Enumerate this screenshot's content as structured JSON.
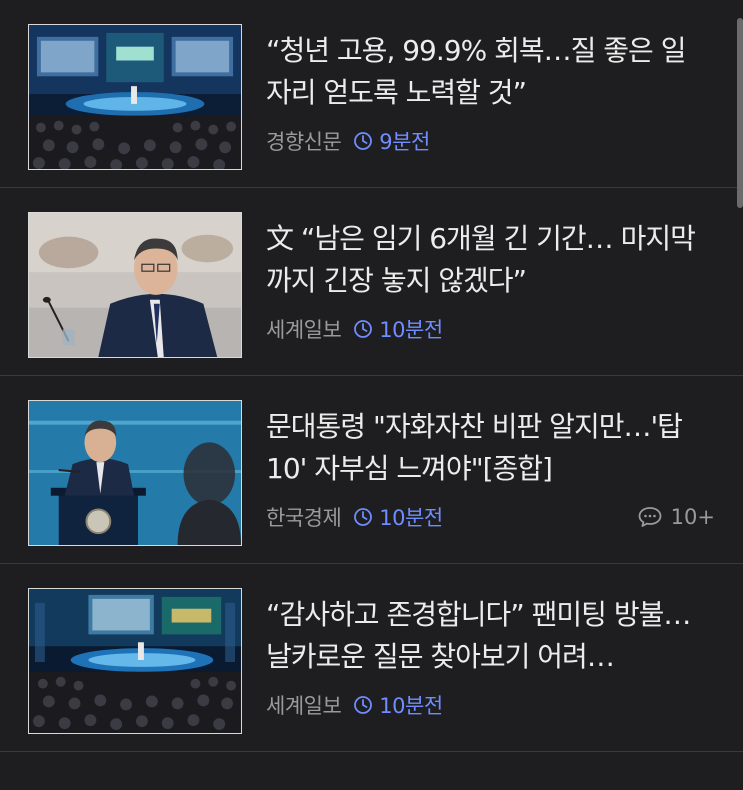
{
  "articles": [
    {
      "title": "“청년 고용, 99.9% 회복…질 좋은 일자리 얻도록 노력할 것”",
      "press": "경향신문",
      "time": "9분전",
      "thumbnail_icon": "townhall-stage-photo"
    },
    {
      "title": "文 “남은 임기 6개월 긴 기간… 마지막까지 긴장 놓지 않겠다”",
      "press": "세계일보",
      "time": "10분전",
      "thumbnail_icon": "president-speaking-photo"
    },
    {
      "title": "문대통령 \"자화자찬 비판 알지만…'탑10' 자부심 느껴야\"[종합]",
      "press": "한국경제",
      "time": "10분전",
      "comment_count": "10+",
      "thumbnail_icon": "president-podium-photo"
    },
    {
      "title": "“감사하고 존경합니다” 팬미팅 방불… 날카로운 질문 찾아보기 어려…",
      "press": "세계일보",
      "time": "10분전",
      "thumbnail_icon": "townhall-stage-photo"
    }
  ],
  "colors": {
    "background": "#1e1e20",
    "title_text": "#ececec",
    "press_text": "#9a9a9c",
    "time_accent": "#6f8dff",
    "divider": "#3a3a3c"
  }
}
